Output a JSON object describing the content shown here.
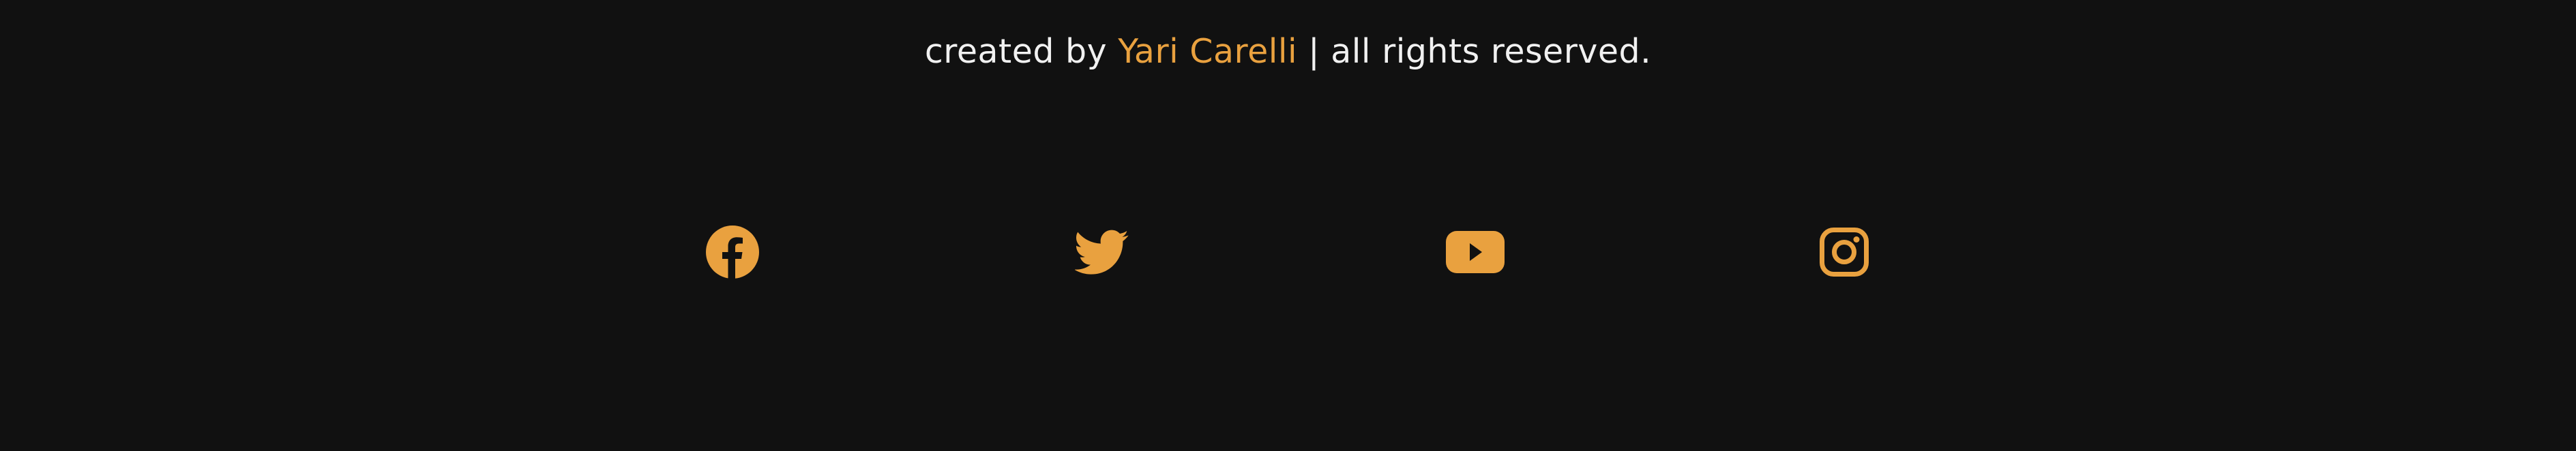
{
  "footer": {
    "credit_prefix": "created by",
    "author_name": "Yari Carelli",
    "credit_suffix": "| all rights reserved."
  },
  "social": [
    {
      "icon": "facebook-icon"
    },
    {
      "icon": "twitter-icon"
    },
    {
      "icon": "youtube-icon"
    },
    {
      "icon": "instagram-icon"
    }
  ],
  "colors": {
    "background": "#111111",
    "text": "#f1f1f1",
    "accent": "#e9a13f"
  }
}
